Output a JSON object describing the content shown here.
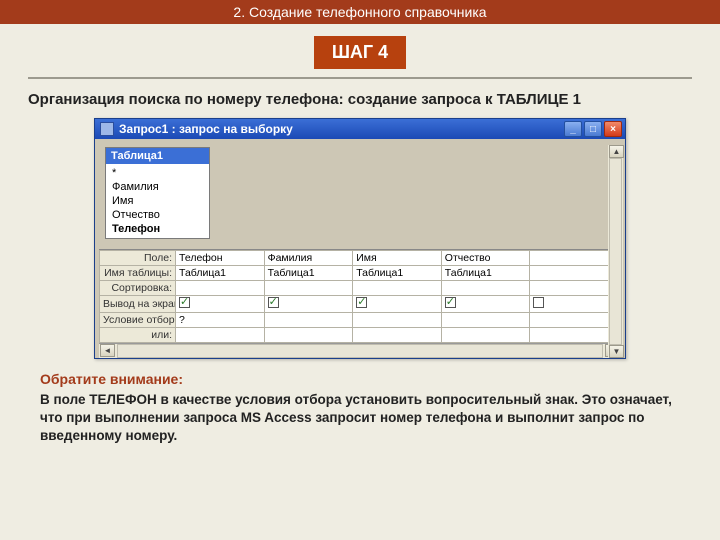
{
  "banner": "2. Создание телефонного справочника",
  "step_label": "ШАГ 4",
  "subtitle": "Организация поиска по номеру телефона: создание запроса к ТАБЛИЦЕ 1",
  "window": {
    "title": "Запрос1 : запрос на выборку",
    "fieldbox": {
      "header": "Таблица1",
      "rows": [
        "*",
        "Фамилия",
        "Имя",
        "Отчество",
        "Телефон"
      ]
    },
    "grid": {
      "row_labels": {
        "field": "Поле:",
        "table": "Имя таблицы:",
        "sort": "Сортировка:",
        "show": "Вывод на экран:",
        "criteria": "Условие отбора:",
        "or": "или:"
      },
      "cols": [
        {
          "field": "Телефон",
          "table": "Таблица1",
          "show": true,
          "criteria": "?"
        },
        {
          "field": "Фамилия",
          "table": "Таблица1",
          "show": true,
          "criteria": ""
        },
        {
          "field": "Имя",
          "table": "Таблица1",
          "show": true,
          "criteria": ""
        },
        {
          "field": "Отчество",
          "table": "Таблица1",
          "show": true,
          "criteria": ""
        }
      ]
    }
  },
  "hint_label": "Обратите внимание:",
  "body_text": " В поле ТЕЛЕФОН в качестве условия отбора установить вопросительный знак. Это означает, что при выполнении запроса MS Access запросит номер телефона и выполнит запрос по введенному номеру."
}
